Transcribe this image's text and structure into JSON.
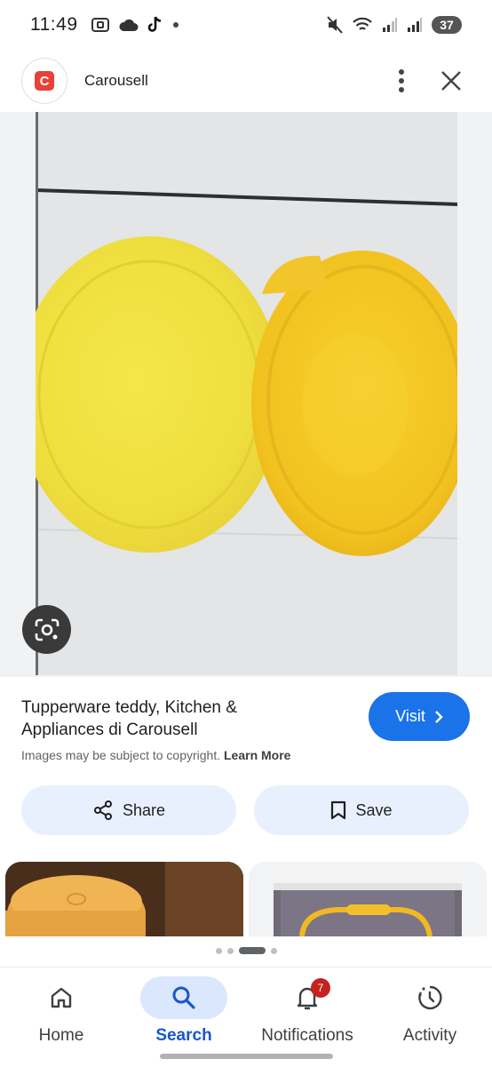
{
  "status_bar": {
    "time": "11:49",
    "battery": "37"
  },
  "header": {
    "app_name": "Carousell",
    "logo_letter": "C"
  },
  "result": {
    "title": "Tupperware teddy, Kitchen & Appliances di Carousell",
    "visit_label": "Visit",
    "copyright_text": "Images may be subject to copyright.",
    "learn_more_label": "Learn More"
  },
  "actions": {
    "share_label": "Share",
    "save_label": "Save"
  },
  "nav": {
    "items": [
      {
        "label": "Home",
        "icon": "home-icon"
      },
      {
        "label": "Search",
        "icon": "search-icon",
        "active": true
      },
      {
        "label": "Notifications",
        "icon": "bell-icon",
        "badge": "7"
      },
      {
        "label": "Activity",
        "icon": "activity-icon"
      }
    ]
  },
  "colors": {
    "accent": "#1a73e8",
    "pill_bg": "#e8f0fe",
    "badge": "#c5221f"
  }
}
